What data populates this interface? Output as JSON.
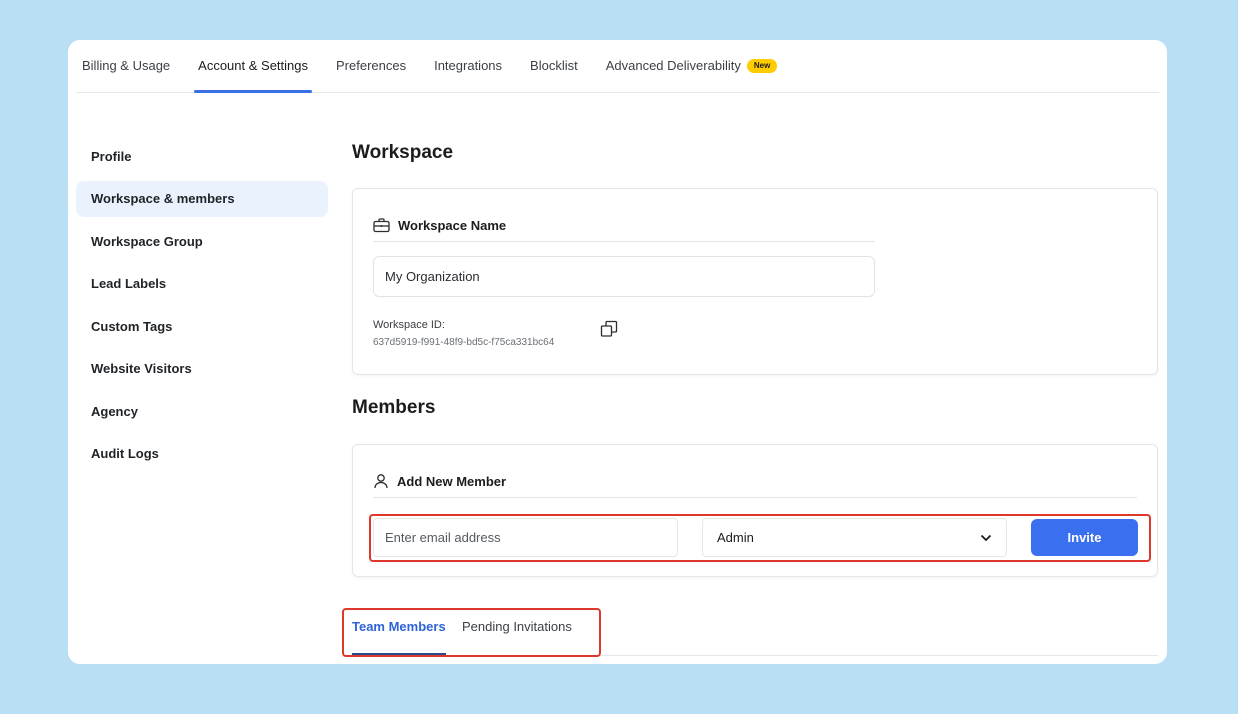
{
  "top_tabs": [
    {
      "label": "Billing & Usage"
    },
    {
      "label": "Account & Settings"
    },
    {
      "label": "Preferences"
    },
    {
      "label": "Integrations"
    },
    {
      "label": "Blocklist"
    },
    {
      "label": "Advanced Deliverability",
      "badge": "New"
    }
  ],
  "sidebar": {
    "items": [
      {
        "label": "Profile"
      },
      {
        "label": "Workspace & members"
      },
      {
        "label": "Workspace Group"
      },
      {
        "label": "Lead Labels"
      },
      {
        "label": "Custom Tags"
      },
      {
        "label": "Website Visitors"
      },
      {
        "label": "Agency"
      },
      {
        "label": "Audit Logs"
      }
    ]
  },
  "workspace": {
    "title": "Workspace",
    "panel_title": "Workspace Name",
    "name_value": "My Organization",
    "id_label": "Workspace ID:",
    "id_value": "637d5919-f991-48f9-bd5c-f75ca331bc64"
  },
  "members": {
    "title": "Members",
    "panel_title": "Add New Member",
    "email_placeholder": "Enter email address",
    "role_value": "Admin",
    "invite_label": "Invite"
  },
  "member_tabs": [
    {
      "label": "Team Members"
    },
    {
      "label": "Pending Invitations"
    }
  ],
  "colors": {
    "accent": "#3a6ff0",
    "highlight": "#e0372b",
    "badge": "#ffcc00",
    "background": "#b9dff5"
  },
  "icons": {
    "workspace": "briefcase-icon",
    "member": "user-icon",
    "copy": "copy-icon",
    "dropdown": "chevron-down-icon"
  }
}
